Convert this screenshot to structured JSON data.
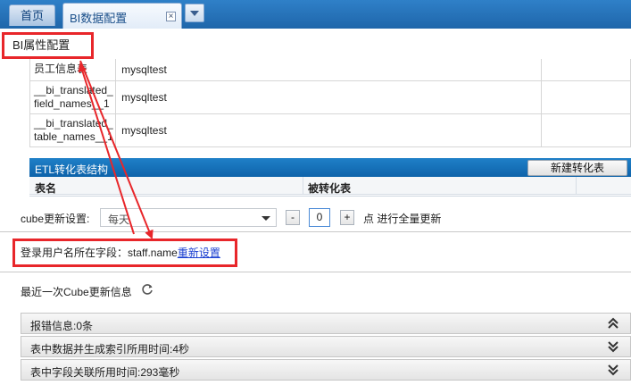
{
  "tabs": {
    "home": "首页",
    "active": "BI数据配置"
  },
  "section_title": "BI属性配置",
  "source_table": {
    "rows": [
      {
        "name_lines": [
          "员工信息表"
        ],
        "db": "mysqltest"
      },
      {
        "name_lines": [
          "__bi_translated_",
          "field_names__1"
        ],
        "db": "mysqltest"
      },
      {
        "name_lines": [
          "__bi_translated_",
          "table_names__1"
        ],
        "db": "mysqltest"
      }
    ]
  },
  "etl": {
    "title": "ETL转化表结构",
    "new_button": "新建转化表",
    "col_table": "表名",
    "col_converted": "被转化表"
  },
  "cube": {
    "label": "cube更新设置:",
    "frequency": "每天",
    "minus": "-",
    "hour": "0",
    "plus": "+",
    "suffix": "点 进行全量更新"
  },
  "login": {
    "label": "登录用户名所在字段：staff.name",
    "reset_link": "重新设置"
  },
  "latest": {
    "label": "最近一次Cube更新信息"
  },
  "info_rows": [
    {
      "label": "报错信息:0条",
      "expanded": true
    },
    {
      "label": "表中数据并生成索引所用时间:4秒",
      "expanded": false
    },
    {
      "label": "表中字段关联所用时间:293毫秒",
      "expanded": false
    }
  ],
  "colors": {
    "tabbar": "#1f66aa",
    "etl_header": "#0e63aa",
    "annotation": "#e8262a",
    "link": "#1a3fd1"
  }
}
